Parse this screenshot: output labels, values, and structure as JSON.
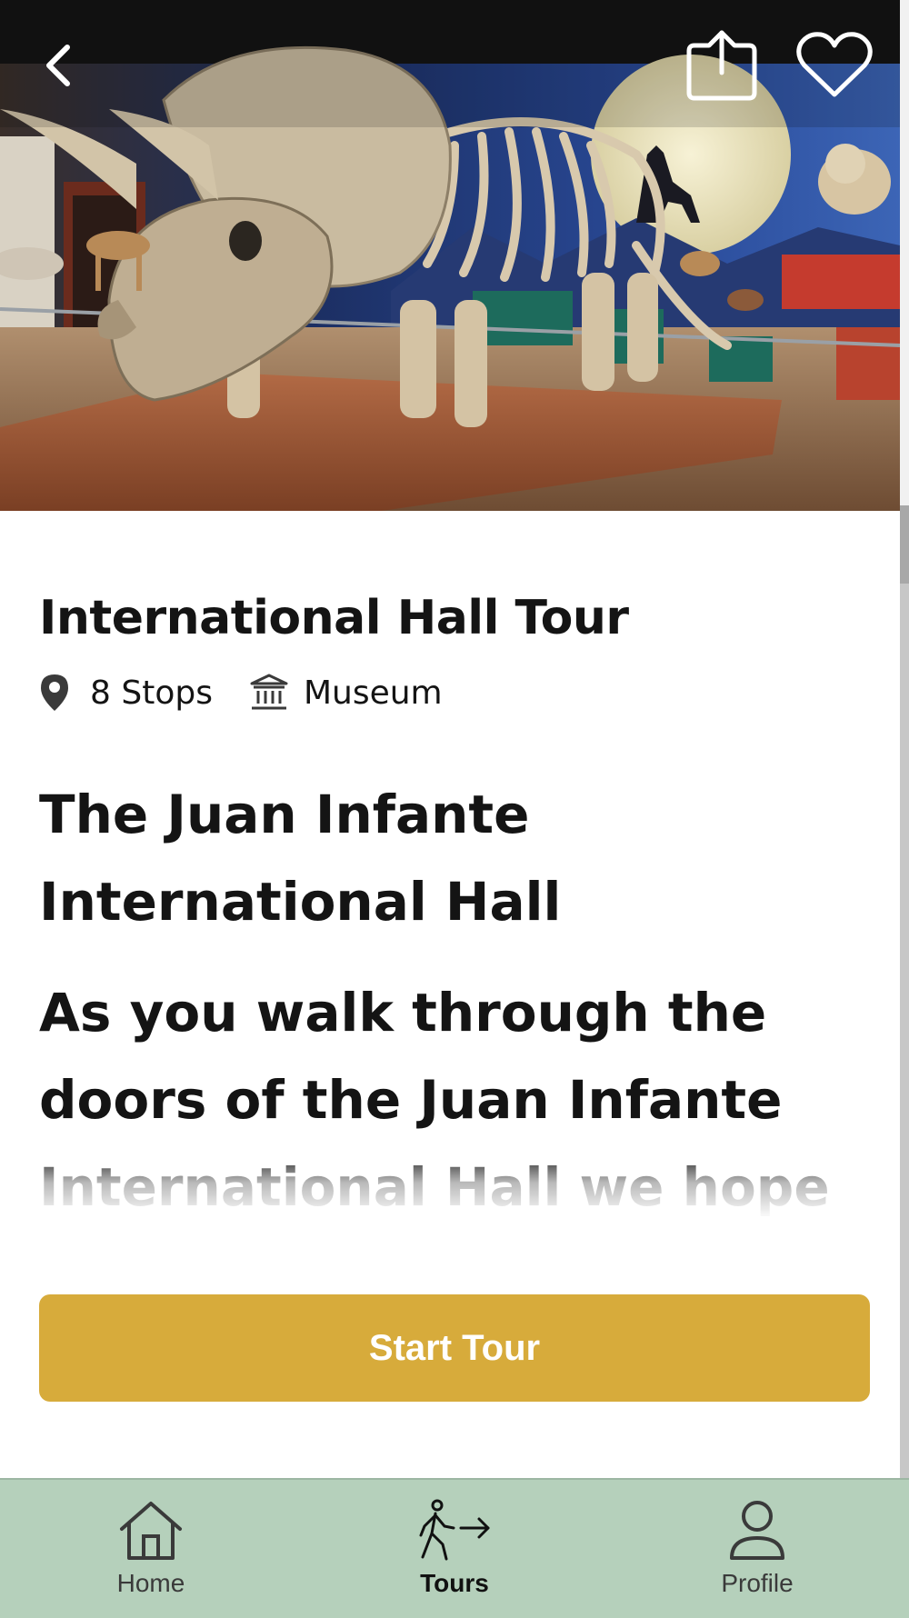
{
  "header": {
    "back_icon": "chevron-left-icon",
    "share_icon": "share-icon",
    "favorite_icon": "heart-icon",
    "hero_image": "museum hall with triceratops skeleton"
  },
  "tour": {
    "title": "International Hall Tour",
    "stops": "8 Stops",
    "category": "Museum",
    "stops_icon": "location-pin-icon",
    "category_icon": "museum-icon"
  },
  "description": {
    "heading": "The Juan Infante International Hall",
    "body": "As you walk through the doors of the Juan Infante International Hall we hope"
  },
  "actions": {
    "start_label": "Start Tour"
  },
  "nav": {
    "items": [
      {
        "label": "Home",
        "icon": "home-icon"
      },
      {
        "label": "Tours",
        "icon": "walking-tour-icon",
        "active": true
      },
      {
        "label": "Profile",
        "icon": "user-icon"
      }
    ]
  },
  "colors": {
    "accent": "#d7ab3b",
    "nav_bg": "#b5d0bb",
    "text": "#141414"
  }
}
